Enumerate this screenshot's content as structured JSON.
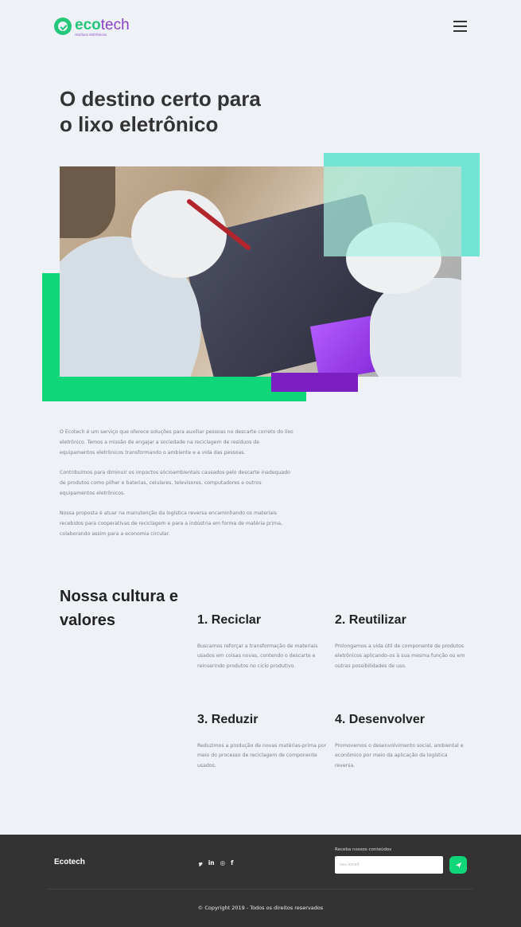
{
  "header": {
    "logo": {
      "eco": "eco",
      "tech": "tech",
      "tagline": "resíduos eletrônicos"
    },
    "menu_icon": "hamburger-menu-icon"
  },
  "hero": {
    "title_line1": "O destino certo para",
    "title_line2": "o lixo eletrônico",
    "image_alt": "Técnico com luvas trabalhando em uma placa eletrônica",
    "colors": {
      "teal": "#72e4d4",
      "green": "#10d67a",
      "purple": "#7b1fc3"
    }
  },
  "about": {
    "paragraphs": [
      "O Ecotech é um serviço que oferece soluções para auxiliar pessoas no descarte correto do lixo eletrônico. Temos a missão de engajar a sociedade na reciclagem de resíduos de equipamentos eletrônicos transformando o ambiente e a vida das pessoas.",
      "Contribuímos para diminuir os impactos sócioambientais causados pelo descarte inadequado de produtos como pilher e baterias, celulares, televisores, computadores e outros equipamentos eletrônicos.",
      "Nossa proposta é atuar na manutenção da logística reversa encaminhando os materiais recebidos para cooperativas de reciclagem e para a indústria em forma de matéria prima, colaborando assim para a economia circular."
    ]
  },
  "culture": {
    "title_line1": "Nossa cultura e",
    "title_line2": "valores",
    "values": [
      {
        "title": "1. Reciclar",
        "text": "Buscamos reforçar a transformação de materiais usados em coisas novas, contendo o descarte e reinserindo produtos no ciclo produtivo."
      },
      {
        "title": "2. Reutilizar",
        "text": "Prolongamos a vida útil de componente de produtos eletrônicos  aplicando-os à sua mesma função ou em outras possibilidades de uso."
      },
      {
        "title": "3. Reduzir",
        "text": "Reduzimos a produção de novas matérias-prima por meio do processo de reciclagem de componente usados."
      },
      {
        "title": "4. Desenvolver",
        "text": "Promovemos o desenvolvimento social, ambiental e econômico por meio da aplicação da logística reversa."
      }
    ]
  },
  "footer": {
    "brand": "Ecotech",
    "social": [
      {
        "icon": "twitter-icon",
        "glyph": "𝔂"
      },
      {
        "icon": "linkedin-icon",
        "glyph": "in"
      },
      {
        "icon": "instagram-icon",
        "glyph": "◎"
      },
      {
        "icon": "facebook-icon",
        "glyph": "f"
      }
    ],
    "newsletter_label": "Receba nossos conteúdos",
    "email_placeholder": "seu email",
    "send_icon": "send-arrow-icon",
    "copyright": "© Copyright 2019 - Todos os direitos reservados"
  }
}
